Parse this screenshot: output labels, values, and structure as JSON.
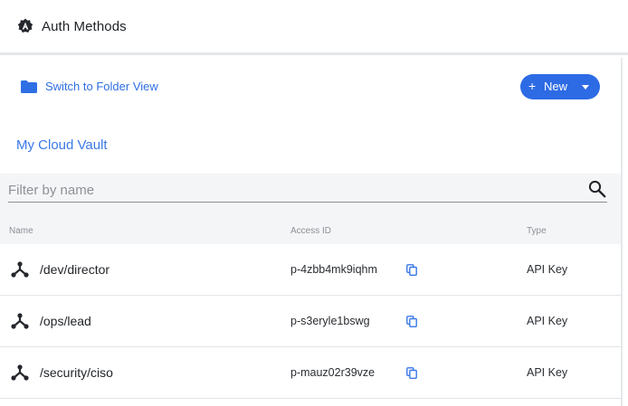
{
  "header": {
    "title": "Auth Methods",
    "icon": "gear-shield-icon"
  },
  "toolbar": {
    "folder_view_label": "Switch to Folder View",
    "new_button": {
      "plus": "+",
      "label": "New"
    },
    "accent_color": "#2d6be5"
  },
  "vault": {
    "name": "My Cloud Vault"
  },
  "filter": {
    "placeholder": "Filter by name",
    "value": ""
  },
  "table": {
    "columns": [
      "Name",
      "Access ID",
      "Type"
    ],
    "rows": [
      {
        "name": "/dev/director",
        "access_id": "p-4zbb4mk9iqhm",
        "type": "API Key"
      },
      {
        "name": "/ops/lead",
        "access_id": "p-s3eryle1bswg",
        "type": "API Key"
      },
      {
        "name": "/security/ciso",
        "access_id": "p-mauz02r39vze",
        "type": "API Key"
      }
    ]
  }
}
